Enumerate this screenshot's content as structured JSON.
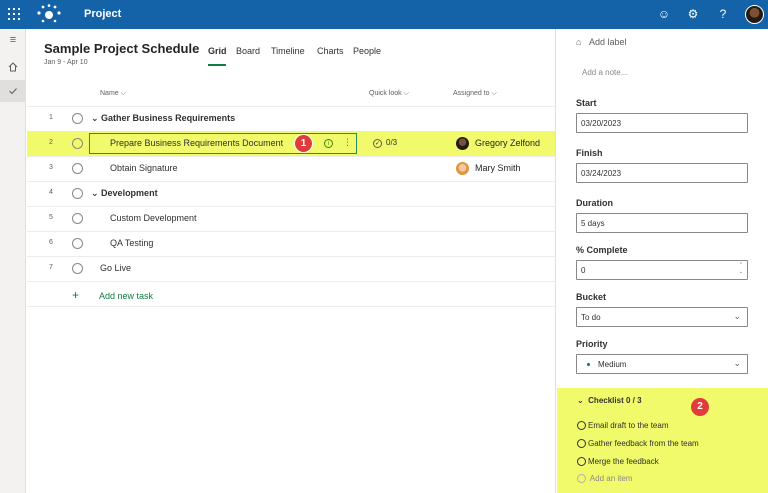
{
  "topbar": {
    "app_title": "Project"
  },
  "plan": {
    "title": "Sample Project Schedule",
    "dates": "Jan 9 - Apr 10"
  },
  "views": [
    "Grid",
    "Board",
    "Timeline",
    "Charts",
    "People"
  ],
  "columns": {
    "name": "Name",
    "quick_look": "Quick look",
    "assigned_to": "Assigned to"
  },
  "rows": [
    {
      "num": "1",
      "name": "Gather Business Requirements"
    },
    {
      "num": "2",
      "name": "Prepare Business Requirements Document",
      "quick_look": "0/3",
      "assignee": "Gregory Zelfond"
    },
    {
      "num": "3",
      "name": "Obtain Signature",
      "assignee": "Mary Smith"
    },
    {
      "num": "4",
      "name": "Development"
    },
    {
      "num": "5",
      "name": "Custom Development"
    },
    {
      "num": "6",
      "name": "QA Testing"
    },
    {
      "num": "7",
      "name": "Go Live"
    }
  ],
  "add_task": "Add new task",
  "annotations": {
    "badge1": "1",
    "badge2": "2"
  },
  "panel": {
    "add_label": "Add label",
    "note_placeholder": "Add a note...",
    "start_label": "Start",
    "start_value": "03/20/2023",
    "finish_label": "Finish",
    "finish_value": "03/24/2023",
    "duration_label": "Duration",
    "duration_value": "5 days",
    "complete_label": "% Complete",
    "complete_value": "0",
    "bucket_label": "Bucket",
    "bucket_value": "To do",
    "priority_label": "Priority",
    "priority_value": "Medium",
    "checklist_title": "Checklist 0 / 3",
    "checklist_items": [
      "Email draft to the team",
      "Gather feedback from the team",
      "Merge the feedback"
    ],
    "checklist_add": "Add an item"
  },
  "colors": {
    "topbar": "#1463a8",
    "highlight": "#f0fa6a",
    "accent_green": "#107c41",
    "badge_red": "#e03c3c"
  }
}
